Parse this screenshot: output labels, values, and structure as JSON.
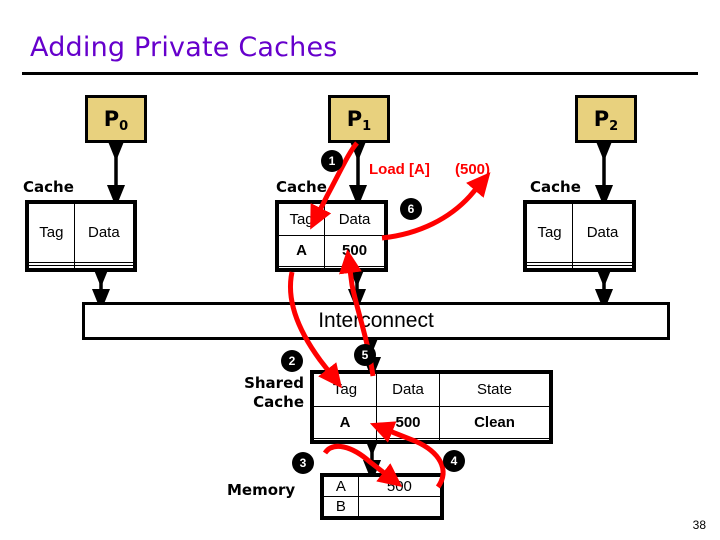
{
  "slide": {
    "title": "Adding Private Caches",
    "page_number": "38",
    "title_color": "#6600CC",
    "accent_color": "#FF0000",
    "processor_fill": "#E8D17E"
  },
  "processors": [
    {
      "name": "P",
      "index": "0",
      "cache_label": "Cache"
    },
    {
      "name": "P",
      "index": "1",
      "cache_label": "Cache"
    },
    {
      "name": "P",
      "index": "2",
      "cache_label": "Cache"
    }
  ],
  "private_caches": [
    {
      "headers": [
        "Tag",
        "Data"
      ],
      "rows": [
        [
          "",
          ""
        ],
        [
          "",
          ""
        ]
      ]
    },
    {
      "headers": [
        "Tag",
        "Data"
      ],
      "rows": [
        [
          "A",
          "500"
        ],
        [
          "",
          ""
        ]
      ]
    },
    {
      "headers": [
        "Tag",
        "Data"
      ],
      "rows": [
        [
          "",
          ""
        ],
        [
          "",
          ""
        ]
      ]
    }
  ],
  "interconnect": {
    "label": "Interconnect"
  },
  "shared_cache": {
    "label_line1": "Shared",
    "label_line2": "Cache",
    "headers": [
      "Tag",
      "Data",
      "State"
    ],
    "rows": [
      [
        "A",
        "500",
        "Clean"
      ],
      [
        "",
        "",
        ""
      ]
    ]
  },
  "memory": {
    "label": "Memory",
    "rows": [
      [
        "A",
        "500"
      ],
      [
        "B",
        ""
      ]
    ]
  },
  "annotations": {
    "load_request": "Load [A]",
    "load_value": "(500)"
  },
  "steps": [
    {
      "n": "1"
    },
    {
      "n": "2"
    },
    {
      "n": "3"
    },
    {
      "n": "4"
    },
    {
      "n": "5"
    },
    {
      "n": "6"
    }
  ]
}
